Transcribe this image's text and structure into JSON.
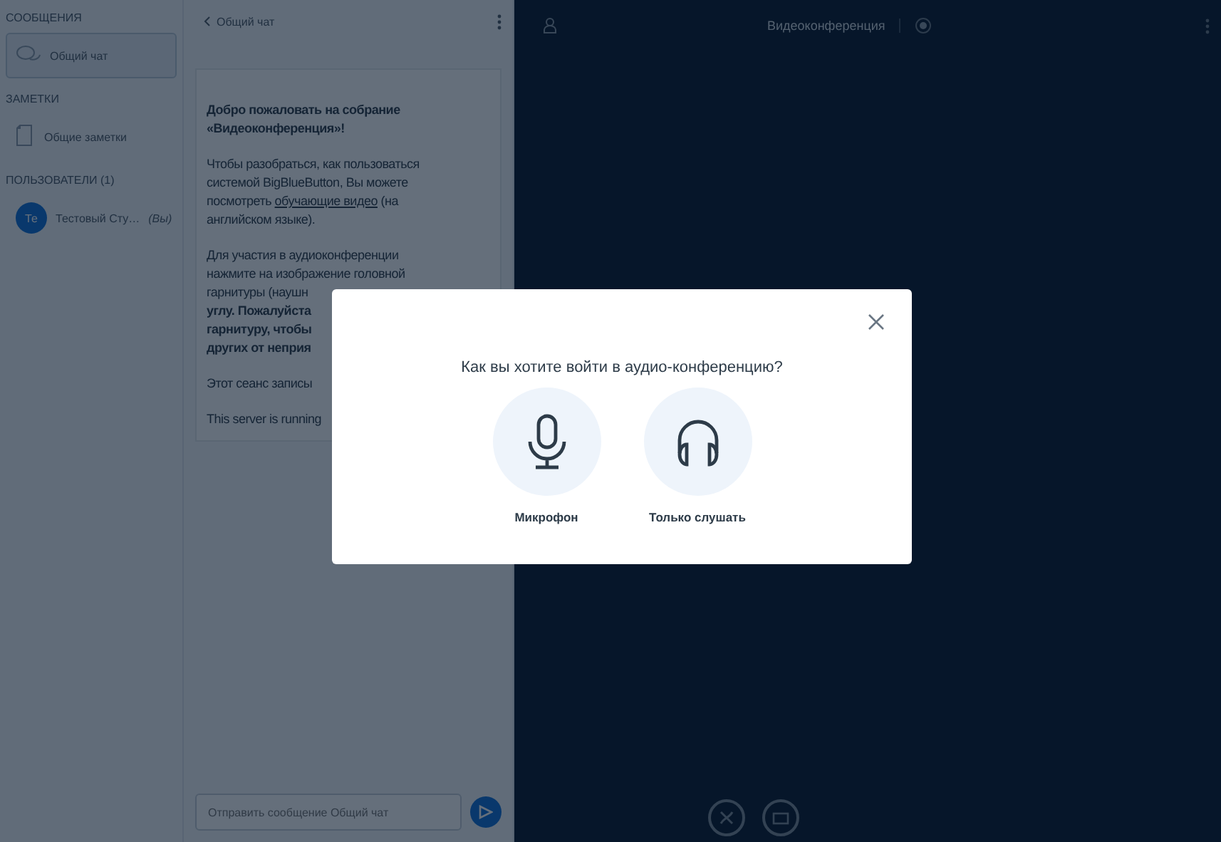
{
  "sidebar": {
    "sections": [
      {
        "title": "СООБЩЕНИЯ",
        "items": [
          {
            "kind": "chat",
            "label": "Общий чат",
            "selected": true
          }
        ]
      },
      {
        "title": "ЗАМЕТКИ",
        "items": [
          {
            "kind": "notes",
            "label": "Общие заметки",
            "selected": false
          }
        ]
      },
      {
        "title": "ПОЛЬЗОВАТЕЛИ (1)",
        "items": [
          {
            "kind": "user",
            "avatar": "Те",
            "label": "Тестовый Сту…",
            "suffix": "(Вы)",
            "selected": false
          }
        ]
      }
    ]
  },
  "chat": {
    "title": "Общий чат",
    "message": [
      [
        "Добро пожаловать на собрание",
        "«**Видеоконференция**»!"
      ],
      [
        "Чтобы разобраться, как пользоваться",
        "системой BigBlueButton, Вы можете",
        {
          "before": "посмотреть",
          "link": "обучающие видео",
          "after": "(на"
        },
        "английском языке)."
      ],
      [
        "Для участия в аудиоконференции",
        "нажмите на изображение головной",
        "гарнитуры (наушн",
        "углу. **Пожалуйста**",
        "гарнитуру, чтобы",
        "других от неприя"
      ],
      [
        "Этот сеанс записы"
      ],
      [
        "This server is running"
      ]
    ],
    "input": {
      "placeholder": "Отправить сообщение Общий чат"
    }
  },
  "main": {
    "title": "Видеоконференция",
    "recording": true
  },
  "modal": {
    "question": "Как вы хотите войти в аудио-конференцию?",
    "options": [
      {
        "kind": "microphone",
        "label": "Микрофон"
      },
      {
        "kind": "listen",
        "label": "Только слушать"
      }
    ]
  }
}
